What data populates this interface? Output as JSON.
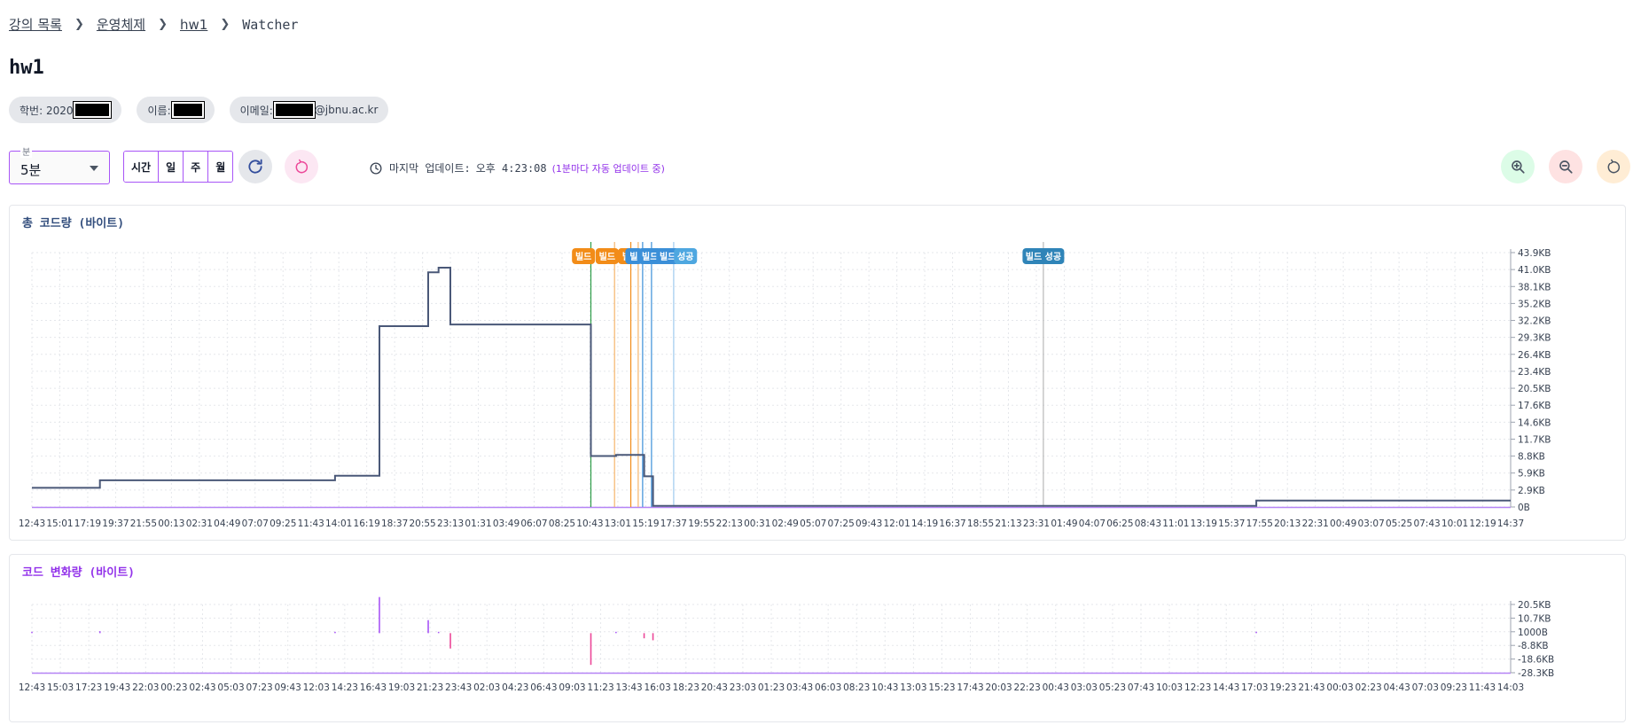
{
  "breadcrumb": {
    "course_list": "강의 목록",
    "course": "운영체제",
    "assignment": "hw1",
    "current": "Watcher"
  },
  "page_title": "hw1",
  "student": {
    "id_label": "학번: 2020",
    "name_label": "이름:",
    "email_label": "이메일:",
    "email_domain": "@jbnu.ac.kr"
  },
  "toolbar": {
    "interval_legend": "분",
    "interval_value": "5분",
    "segments": [
      "시간",
      "일",
      "주",
      "월"
    ],
    "update_label": "마지막 업데이트:",
    "update_time": "오후 4:23:08",
    "update_note": "(1분마다 자동 업데이트 중)"
  },
  "colors": {
    "accent": "#a855f7",
    "line_total": "#4a5878",
    "build_orange": "#f28c18",
    "build_blue": "#3b8fd8",
    "build_success": "#2f84b8",
    "change_positive": "#a855f7",
    "change_negative": "#ec4899"
  },
  "chart_data": [
    {
      "type": "line",
      "title": "총 코드량 (바이트)",
      "y_ticks": [
        "0B",
        "2.9KB",
        "5.9KB",
        "8.8KB",
        "11.7KB",
        "14.6KB",
        "17.6KB",
        "20.5KB",
        "23.4KB",
        "26.4KB",
        "29.3KB",
        "32.2KB",
        "35.2KB",
        "38.1KB",
        "41.0KB",
        "43.9KB"
      ],
      "ylim": [
        0,
        43.9
      ],
      "yunit": "KB",
      "x_ticks": [
        "12:43",
        "15:01",
        "17:19",
        "19:37",
        "21:55",
        "00:13",
        "02:31",
        "04:49",
        "07:07",
        "09:25",
        "11:43",
        "14:01",
        "16:19",
        "18:37",
        "20:55",
        "23:13",
        "01:31",
        "03:49",
        "06:07",
        "08:25",
        "10:43",
        "13:01",
        "15:19",
        "17:37",
        "19:55",
        "22:13",
        "00:31",
        "02:49",
        "05:07",
        "07:25",
        "09:43",
        "12:01",
        "14:19",
        "16:37",
        "18:55",
        "21:13",
        "23:31",
        "01:49",
        "04:07",
        "06:25",
        "08:43",
        "11:01",
        "13:19",
        "15:37",
        "17:55",
        "20:13",
        "22:31",
        "00:49",
        "03:07",
        "05:25",
        "07:43",
        "10:01",
        "12:19",
        "14:37"
      ],
      "xlim": [
        0,
        1
      ],
      "series": [
        {
          "values": [
            [
              0.0,
              3.3
            ],
            [
              0.046,
              3.3
            ],
            [
              0.046,
              4.6
            ],
            [
              0.205,
              4.6
            ],
            [
              0.205,
              5.4
            ],
            [
              0.235,
              5.4
            ],
            [
              0.235,
              31.2
            ],
            [
              0.268,
              31.2
            ],
            [
              0.268,
              40.5
            ],
            [
              0.275,
              40.5
            ],
            [
              0.275,
              41.3
            ],
            [
              0.283,
              41.3
            ],
            [
              0.283,
              31.5
            ],
            [
              0.378,
              31.5
            ],
            [
              0.378,
              8.8
            ],
            [
              0.395,
              8.8
            ],
            [
              0.395,
              9.0
            ],
            [
              0.414,
              9.0
            ],
            [
              0.414,
              5.3
            ],
            [
              0.42,
              5.3
            ],
            [
              0.42,
              0.2
            ],
            [
              0.828,
              0.2
            ],
            [
              0.828,
              1.1
            ],
            [
              1.0,
              1.1
            ]
          ]
        }
      ],
      "build_events": [
        {
          "x": 0.378,
          "color": "#2e9d48"
        },
        {
          "x": 0.394,
          "color": "#f5b46a"
        },
        {
          "x": 0.405,
          "color": "#f28c18"
        },
        {
          "x": 0.41,
          "color": "#f5b46a"
        },
        {
          "x": 0.413,
          "color": "#3b8fd8"
        },
        {
          "x": 0.419,
          "color": "#3b8fd8"
        },
        {
          "x": 0.434,
          "color": "#9ecbef"
        },
        {
          "x": 0.684,
          "color": "#b9b9b9"
        }
      ],
      "build_tags": [
        {
          "text": "빌드",
          "x": 0.373,
          "color": "#f28c18"
        },
        {
          "text": "빌드",
          "x": 0.389,
          "color": "#f28c18"
        },
        {
          "text": "빌",
          "x": 0.402,
          "color": "#f28c18"
        },
        {
          "text": "빌",
          "x": 0.407,
          "color": "#3b8fd8"
        },
        {
          "text": "빌드",
          "x": 0.418,
          "color": "#3b8fd8"
        },
        {
          "text": "빌드",
          "x": 0.43,
          "color": "#3b8fd8"
        },
        {
          "text": "성공",
          "x": 0.442,
          "color": "#4ea7e0"
        },
        {
          "text": "빌드 성공",
          "x": 0.684,
          "color": "#2f84b8"
        }
      ]
    },
    {
      "type": "bar",
      "title": "코드 변화량 (바이트)",
      "y_ticks": [
        "-28.3KB",
        "-18.6KB",
        "-8.8KB",
        "1000B",
        "10.7KB",
        "20.5KB"
      ],
      "ylim": [
        -28.3,
        20.5
      ],
      "yunit": "KB",
      "x_ticks": [
        "12:43",
        "15:03",
        "17:23",
        "19:43",
        "22:03",
        "00:23",
        "02:43",
        "05:03",
        "07:23",
        "09:43",
        "12:03",
        "14:23",
        "16:43",
        "19:03",
        "21:23",
        "23:43",
        "02:03",
        "04:23",
        "06:43",
        "09:03",
        "11:23",
        "13:43",
        "16:03",
        "18:23",
        "20:43",
        "23:03",
        "01:23",
        "03:43",
        "06:03",
        "08:23",
        "10:43",
        "13:03",
        "15:23",
        "17:43",
        "20:03",
        "22:23",
        "00:43",
        "03:03",
        "05:23",
        "07:43",
        "10:03",
        "12:23",
        "14:43",
        "17:03",
        "19:23",
        "21:43",
        "00:03",
        "02:23",
        "04:43",
        "07:03",
        "09:23",
        "11:43",
        "14:03"
      ],
      "xlim": [
        0,
        1
      ],
      "series": [
        {
          "values": [
            [
              0.0,
              0.9
            ],
            [
              0.046,
              1.4
            ],
            [
              0.205,
              0.8
            ],
            [
              0.235,
              25.8
            ],
            [
              0.268,
              9.3
            ],
            [
              0.275,
              0.8
            ],
            [
              0.283,
              -11.0
            ],
            [
              0.378,
              -22.7
            ],
            [
              0.395,
              0.2
            ],
            [
              0.414,
              -3.7
            ],
            [
              0.42,
              -5.1
            ],
            [
              0.828,
              0.9
            ]
          ]
        }
      ]
    }
  ]
}
